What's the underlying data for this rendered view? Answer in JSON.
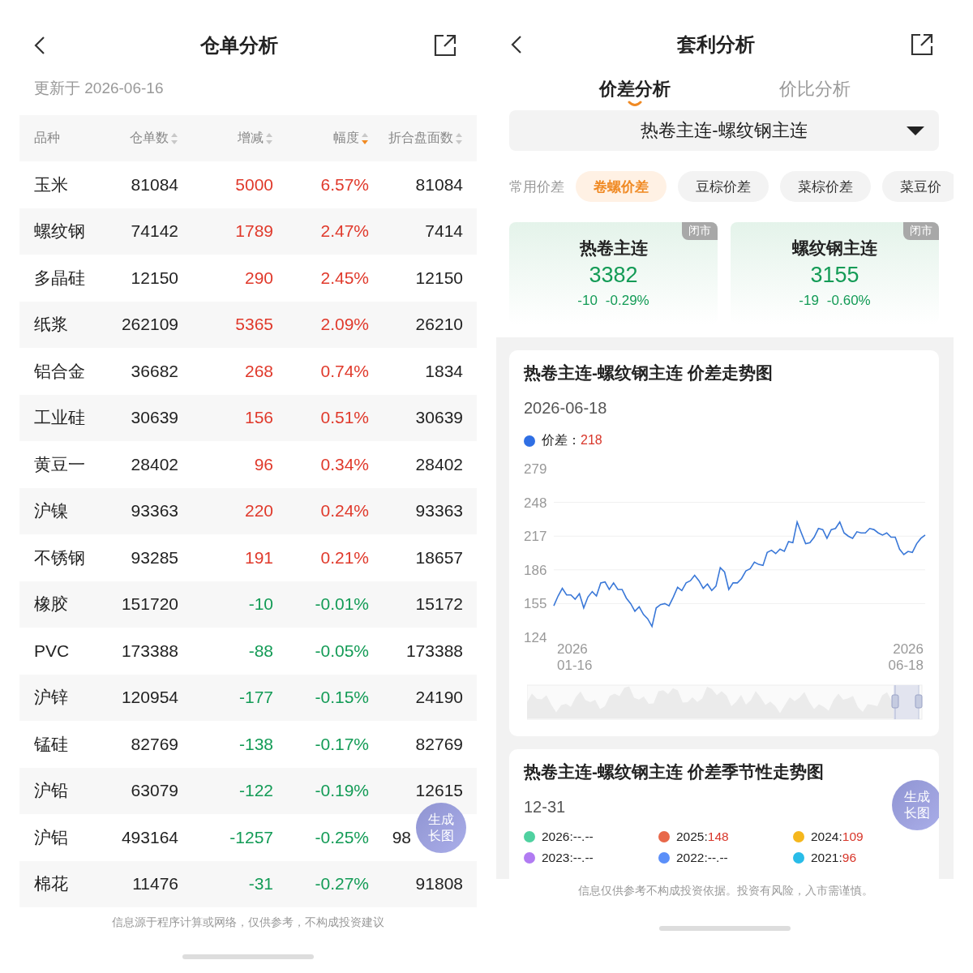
{
  "left": {
    "header": {
      "title": "仓单分析"
    },
    "updated": "更新于 2026-06-16",
    "table": {
      "columns": [
        {
          "label": "品种"
        },
        {
          "label": "仓单数",
          "sorted_desc": false
        },
        {
          "label": "增减",
          "sorted_desc": false
        },
        {
          "label": "幅度",
          "sorted_desc": true
        },
        {
          "label": "折合盘面数",
          "sorted_desc": false
        }
      ],
      "rows": [
        {
          "name": "玉米",
          "count": "81084",
          "change": "5000",
          "pct": "6.57%",
          "folded": "81084",
          "rising": true
        },
        {
          "name": "螺纹钢",
          "count": "74142",
          "change": "1789",
          "pct": "2.47%",
          "folded": "7414",
          "rising": true
        },
        {
          "name": "多晶硅",
          "count": "12150",
          "change": "290",
          "pct": "2.45%",
          "folded": "12150",
          "rising": true
        },
        {
          "name": "纸浆",
          "count": "262109",
          "change": "5365",
          "pct": "2.09%",
          "folded": "26210",
          "rising": true
        },
        {
          "name": "铝合金",
          "count": "36682",
          "change": "268",
          "pct": "0.74%",
          "folded": "1834",
          "rising": true
        },
        {
          "name": "工业硅",
          "count": "30639",
          "change": "156",
          "pct": "0.51%",
          "folded": "30639",
          "rising": true
        },
        {
          "name": "黄豆一",
          "count": "28402",
          "change": "96",
          "pct": "0.34%",
          "folded": "28402",
          "rising": true
        },
        {
          "name": "沪镍",
          "count": "93363",
          "change": "220",
          "pct": "0.24%",
          "folded": "93363",
          "rising": true
        },
        {
          "name": "不锈钢",
          "count": "93285",
          "change": "191",
          "pct": "0.21%",
          "folded": "18657",
          "rising": true
        },
        {
          "name": "橡胶",
          "count": "151720",
          "change": "-10",
          "pct": "-0.01%",
          "folded": "15172",
          "rising": false
        },
        {
          "name": "PVC",
          "count": "173388",
          "change": "-88",
          "pct": "-0.05%",
          "folded": "173388",
          "rising": false
        },
        {
          "name": "沪锌",
          "count": "120954",
          "change": "-177",
          "pct": "-0.15%",
          "folded": "24190",
          "rising": false
        },
        {
          "name": "锰硅",
          "count": "82769",
          "change": "-138",
          "pct": "-0.17%",
          "folded": "82769",
          "rising": false
        },
        {
          "name": "沪铅",
          "count": "63079",
          "change": "-122",
          "pct": "-0.19%",
          "folded": "12615",
          "rising": false
        },
        {
          "name": "沪铝",
          "count": "493164",
          "change": "-1257",
          "pct": "-0.25%",
          "folded": "98",
          "rising": false,
          "float_button": [
            "生成",
            "长图"
          ]
        },
        {
          "name": "棉花",
          "count": "11476",
          "change": "-31",
          "pct": "-0.27%",
          "folded": "91808",
          "rising": false
        }
      ]
    },
    "footer": "信息源于程序计算或网络，仅供参考，不构成投资建议"
  },
  "right": {
    "header": {
      "title": "套利分析"
    },
    "tabs": [
      {
        "label": "价差分析",
        "selected": true
      },
      {
        "label": "价比分析",
        "selected": false
      }
    ],
    "selector": {
      "value": "热卷主连-螺纹钢主连"
    },
    "chips": {
      "label": "常用价差",
      "items": [
        {
          "label": "卷螺价差",
          "selected": true
        },
        {
          "label": "豆棕价差",
          "selected": false
        },
        {
          "label": "菜棕价差",
          "selected": false
        },
        {
          "label": "菜豆价",
          "selected": false
        }
      ]
    },
    "quotes": [
      {
        "name": "热卷主连",
        "price": "3382",
        "change": "-10",
        "pct": "-0.29%",
        "status": "闭市",
        "rising": false
      },
      {
        "name": "螺纹钢主连",
        "price": "3155",
        "change": "-19",
        "pct": "-0.60%",
        "status": "闭市",
        "rising": false
      }
    ],
    "trend_chart": {
      "title": "热卷主连-螺纹钢主连 价差走势图",
      "date": "2026-06-18",
      "legend": {
        "label": "价差：",
        "value": "218",
        "color": "#2f6fe4"
      },
      "x_labels": [
        [
          "2026",
          "01-16"
        ],
        [
          "2026",
          "06-18"
        ]
      ],
      "chart_data": {
        "type": "line",
        "series": [
          {
            "color": "#3a78d8",
            "values": [
              153,
              162,
              169,
              163,
              163,
              159,
              164,
              151,
              161,
              166,
              162,
              174,
              175,
              168,
              174,
              168,
              168,
              160,
              155,
              148,
              152,
              145,
              141,
              134,
              151,
              154,
              155,
              153,
              161,
              170,
              167,
              174,
              176,
              181,
              176,
              169,
              173,
              167,
              171,
              188,
              184,
              168,
              174,
              174,
              178,
              185,
              187,
              193,
              191,
              190,
              202,
              204,
              201,
              205,
              203,
              212,
              211,
              230,
              220,
              210,
              211,
              216,
              224,
              223,
              215,
              223,
              224,
              230,
              220,
              217,
              215,
              221,
              220,
              220,
              224,
              223,
              220,
              218,
              220,
              216,
              216,
              205,
              200,
              203,
              202,
              210,
              215,
              218
            ]
          }
        ],
        "ylim": [
          124,
          279
        ],
        "yticks": [
          124,
          155,
          186,
          217,
          248,
          279
        ],
        "grid": true
      }
    },
    "seasonal": {
      "title": "热卷主连-螺纹钢主连 价差季节性走势图",
      "date": "12-31",
      "float_button": [
        "生成",
        "长图"
      ],
      "legend": [
        {
          "year": "2026:",
          "value": "--.--",
          "color": "#4fd1a0",
          "has_value": false
        },
        {
          "year": "2025:",
          "value": "148",
          "color": "#e8684a",
          "has_value": true
        },
        {
          "year": "2024:",
          "value": "109",
          "color": "#f5b71d",
          "has_value": true
        },
        {
          "year": "2023:",
          "value": "--.--",
          "color": "#b17bf2",
          "has_value": false
        },
        {
          "year": "2022:",
          "value": "--.--",
          "color": "#5b8ff9",
          "has_value": false
        },
        {
          "year": "2021:",
          "value": "96",
          "color": "#29bce8",
          "has_value": true
        }
      ]
    },
    "footer": "信息仅供参考不构成投资依据。投资有风险，入市需谨慎。"
  }
}
